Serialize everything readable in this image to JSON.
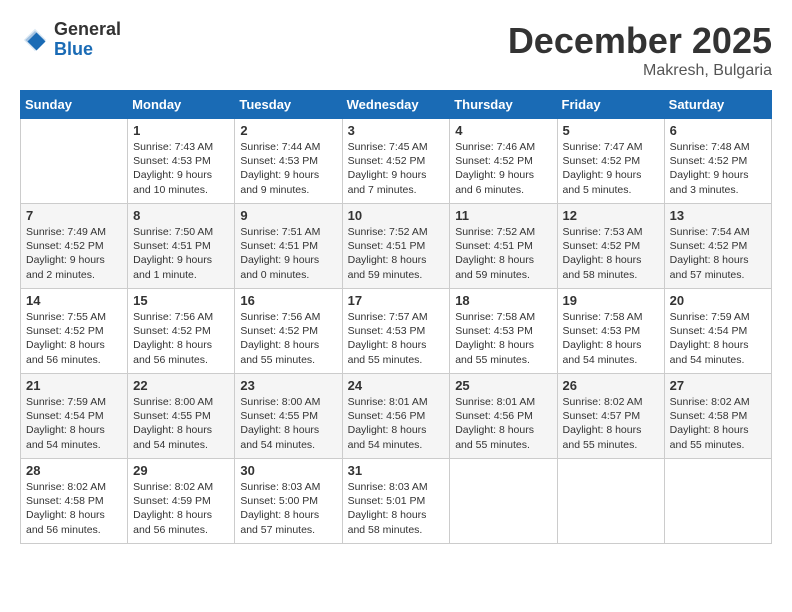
{
  "header": {
    "logo_general": "General",
    "logo_blue": "Blue",
    "month_title": "December 2025",
    "location": "Makresh, Bulgaria"
  },
  "weekdays": [
    "Sunday",
    "Monday",
    "Tuesday",
    "Wednesday",
    "Thursday",
    "Friday",
    "Saturday"
  ],
  "weeks": [
    [
      {
        "day": "",
        "info": ""
      },
      {
        "day": "1",
        "info": "Sunrise: 7:43 AM\nSunset: 4:53 PM\nDaylight: 9 hours\nand 10 minutes."
      },
      {
        "day": "2",
        "info": "Sunrise: 7:44 AM\nSunset: 4:53 PM\nDaylight: 9 hours\nand 9 minutes."
      },
      {
        "day": "3",
        "info": "Sunrise: 7:45 AM\nSunset: 4:52 PM\nDaylight: 9 hours\nand 7 minutes."
      },
      {
        "day": "4",
        "info": "Sunrise: 7:46 AM\nSunset: 4:52 PM\nDaylight: 9 hours\nand 6 minutes."
      },
      {
        "day": "5",
        "info": "Sunrise: 7:47 AM\nSunset: 4:52 PM\nDaylight: 9 hours\nand 5 minutes."
      },
      {
        "day": "6",
        "info": "Sunrise: 7:48 AM\nSunset: 4:52 PM\nDaylight: 9 hours\nand 3 minutes."
      }
    ],
    [
      {
        "day": "7",
        "info": "Sunrise: 7:49 AM\nSunset: 4:52 PM\nDaylight: 9 hours\nand 2 minutes."
      },
      {
        "day": "8",
        "info": "Sunrise: 7:50 AM\nSunset: 4:51 PM\nDaylight: 9 hours\nand 1 minute."
      },
      {
        "day": "9",
        "info": "Sunrise: 7:51 AM\nSunset: 4:51 PM\nDaylight: 9 hours\nand 0 minutes."
      },
      {
        "day": "10",
        "info": "Sunrise: 7:52 AM\nSunset: 4:51 PM\nDaylight: 8 hours\nand 59 minutes."
      },
      {
        "day": "11",
        "info": "Sunrise: 7:52 AM\nSunset: 4:51 PM\nDaylight: 8 hours\nand 59 minutes."
      },
      {
        "day": "12",
        "info": "Sunrise: 7:53 AM\nSunset: 4:52 PM\nDaylight: 8 hours\nand 58 minutes."
      },
      {
        "day": "13",
        "info": "Sunrise: 7:54 AM\nSunset: 4:52 PM\nDaylight: 8 hours\nand 57 minutes."
      }
    ],
    [
      {
        "day": "14",
        "info": "Sunrise: 7:55 AM\nSunset: 4:52 PM\nDaylight: 8 hours\nand 56 minutes."
      },
      {
        "day": "15",
        "info": "Sunrise: 7:56 AM\nSunset: 4:52 PM\nDaylight: 8 hours\nand 56 minutes."
      },
      {
        "day": "16",
        "info": "Sunrise: 7:56 AM\nSunset: 4:52 PM\nDaylight: 8 hours\nand 55 minutes."
      },
      {
        "day": "17",
        "info": "Sunrise: 7:57 AM\nSunset: 4:53 PM\nDaylight: 8 hours\nand 55 minutes."
      },
      {
        "day": "18",
        "info": "Sunrise: 7:58 AM\nSunset: 4:53 PM\nDaylight: 8 hours\nand 55 minutes."
      },
      {
        "day": "19",
        "info": "Sunrise: 7:58 AM\nSunset: 4:53 PM\nDaylight: 8 hours\nand 54 minutes."
      },
      {
        "day": "20",
        "info": "Sunrise: 7:59 AM\nSunset: 4:54 PM\nDaylight: 8 hours\nand 54 minutes."
      }
    ],
    [
      {
        "day": "21",
        "info": "Sunrise: 7:59 AM\nSunset: 4:54 PM\nDaylight: 8 hours\nand 54 minutes."
      },
      {
        "day": "22",
        "info": "Sunrise: 8:00 AM\nSunset: 4:55 PM\nDaylight: 8 hours\nand 54 minutes."
      },
      {
        "day": "23",
        "info": "Sunrise: 8:00 AM\nSunset: 4:55 PM\nDaylight: 8 hours\nand 54 minutes."
      },
      {
        "day": "24",
        "info": "Sunrise: 8:01 AM\nSunset: 4:56 PM\nDaylight: 8 hours\nand 54 minutes."
      },
      {
        "day": "25",
        "info": "Sunrise: 8:01 AM\nSunset: 4:56 PM\nDaylight: 8 hours\nand 55 minutes."
      },
      {
        "day": "26",
        "info": "Sunrise: 8:02 AM\nSunset: 4:57 PM\nDaylight: 8 hours\nand 55 minutes."
      },
      {
        "day": "27",
        "info": "Sunrise: 8:02 AM\nSunset: 4:58 PM\nDaylight: 8 hours\nand 55 minutes."
      }
    ],
    [
      {
        "day": "28",
        "info": "Sunrise: 8:02 AM\nSunset: 4:58 PM\nDaylight: 8 hours\nand 56 minutes."
      },
      {
        "day": "29",
        "info": "Sunrise: 8:02 AM\nSunset: 4:59 PM\nDaylight: 8 hours\nand 56 minutes."
      },
      {
        "day": "30",
        "info": "Sunrise: 8:03 AM\nSunset: 5:00 PM\nDaylight: 8 hours\nand 57 minutes."
      },
      {
        "day": "31",
        "info": "Sunrise: 8:03 AM\nSunset: 5:01 PM\nDaylight: 8 hours\nand 58 minutes."
      },
      {
        "day": "",
        "info": ""
      },
      {
        "day": "",
        "info": ""
      },
      {
        "day": "",
        "info": ""
      }
    ]
  ]
}
